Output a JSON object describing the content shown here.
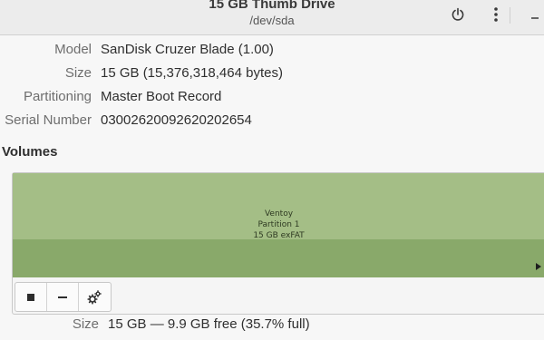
{
  "header": {
    "title": "15 GB Thumb Drive",
    "subtitle": "/dev/sda",
    "power_icon": "power-icon",
    "menu_icon": "vertical-dots-menu-icon"
  },
  "drive": {
    "model_label": "Model",
    "model_value": "SanDisk Cruzer Blade (1.00)",
    "size_label": "Size",
    "size_value": "15 GB (15,376,318,464 bytes)",
    "partitioning_label": "Partitioning",
    "partitioning_value": "Master Boot Record",
    "serial_label": "Serial Number",
    "serial_value": "03002620092620202654"
  },
  "volumes": {
    "title": "Volumes",
    "partition": {
      "name": "Ventoy",
      "number": "Partition 1",
      "fs": "15 GB exFAT",
      "color": "#a4be86"
    },
    "toolbar": {
      "stop_icon": "stop-icon",
      "remove_icon": "minus-icon",
      "settings_icon": "gears-icon"
    }
  },
  "volume_details": {
    "size_label": "Size",
    "size_value": "15 GB — 9.9 GB free (35.7% full)"
  }
}
